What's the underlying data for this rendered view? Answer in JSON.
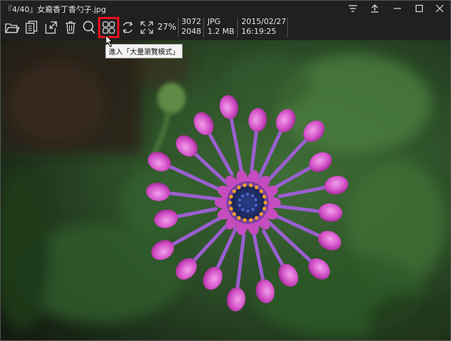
{
  "window": {
    "title": "『4/40』女裔香丁香勺子.jpg"
  },
  "controls": {
    "menu": "menu-icon",
    "upload": "upload-icon",
    "minimize": "minimize-icon",
    "maximize": "maximize-icon",
    "close": "close-icon"
  },
  "toolbar": {
    "zoom": "27%",
    "tooltip": "進入「大量瀏覽模式」",
    "icons": [
      "open-folder-icon",
      "copy-icon",
      "move-icon",
      "delete-icon",
      "search-icon",
      "grid-icon",
      "rotate-icon",
      "fullscreen-icon"
    ]
  },
  "info": {
    "width": "3072",
    "height": "2048",
    "format": "JPG",
    "size": "1.2 MB",
    "date": "2015/02/27",
    "time": "16:19:25"
  },
  "colors": {
    "highlight": "#e8101a",
    "background": "#202020",
    "petal": "#d44fc8",
    "leaf": "#2f5a2c"
  }
}
